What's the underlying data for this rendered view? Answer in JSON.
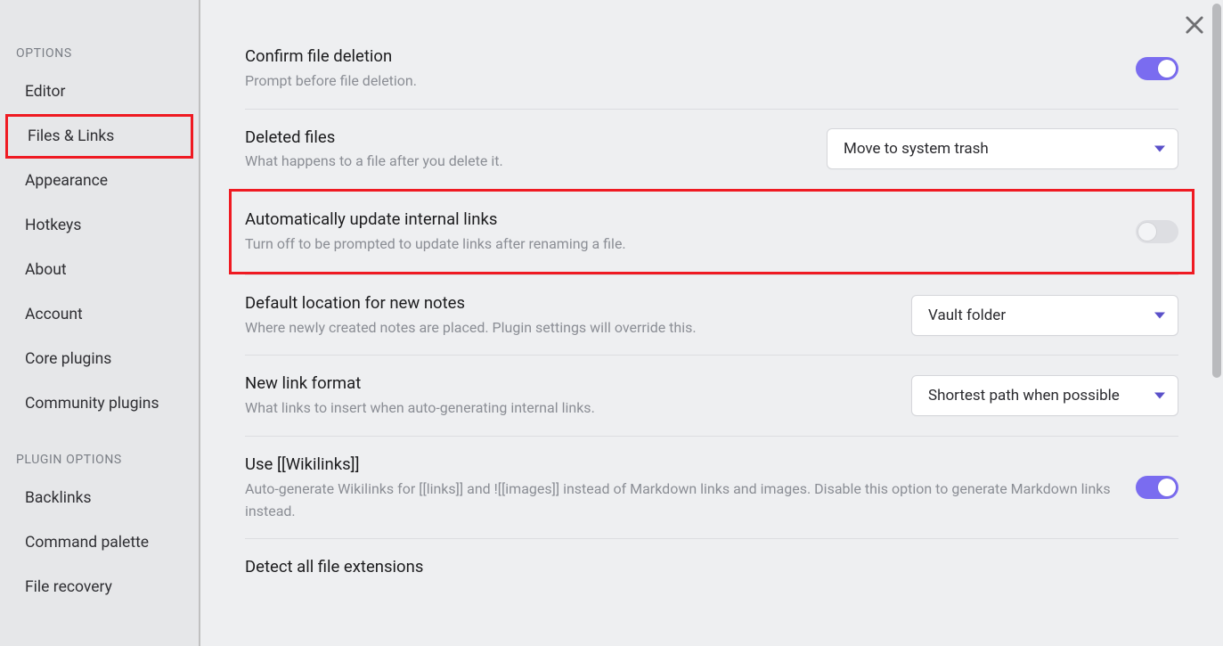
{
  "sidebar": {
    "sections": {
      "options": {
        "header": "OPTIONS",
        "items": [
          "Editor",
          "Files & Links",
          "Appearance",
          "Hotkeys",
          "About",
          "Account",
          "Core plugins",
          "Community plugins"
        ],
        "active_index": 1
      },
      "plugin_options": {
        "header": "PLUGIN OPTIONS",
        "items": [
          "Backlinks",
          "Command palette",
          "File recovery"
        ]
      }
    }
  },
  "settings": {
    "confirm_delete": {
      "title": "Confirm file deletion",
      "desc": "Prompt before file deletion.",
      "toggle_on": true
    },
    "deleted_files": {
      "title": "Deleted files",
      "desc": "What happens to a file after you delete it.",
      "dropdown_value": "Move to system trash"
    },
    "auto_update_links": {
      "title": "Automatically update internal links",
      "desc": "Turn off to be prompted to update links after renaming a file.",
      "toggle_on": false
    },
    "default_location": {
      "title": "Default location for new notes",
      "desc": "Where newly created notes are placed. Plugin settings will override this.",
      "dropdown_value": "Vault folder"
    },
    "new_link_format": {
      "title": "New link format",
      "desc": "What links to insert when auto-generating internal links.",
      "dropdown_value": "Shortest path when possible"
    },
    "use_wikilinks": {
      "title": "Use [[Wikilinks]]",
      "desc": "Auto-generate Wikilinks for [[links]] and ![[images]] instead of Markdown links and images. Disable this option to generate Markdown links instead.",
      "toggle_on": true
    },
    "detect_ext": {
      "title": "Detect all file extensions"
    }
  },
  "colors": {
    "accent": "#7a6cf0",
    "highlight": "#ef1a22"
  }
}
